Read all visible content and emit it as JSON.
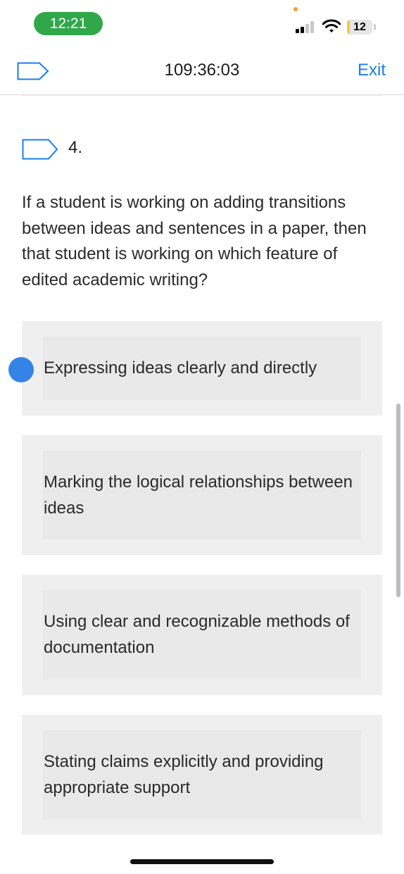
{
  "status_bar": {
    "time": "12:21",
    "battery_level": "12",
    "battery_fraction": 0.12,
    "signal_icon": "cellular-signal-icon",
    "wifi_icon": "wifi-icon",
    "battery_icon": "battery-icon"
  },
  "header": {
    "flag_icon": "flag-outline-icon",
    "timer": "109:36:03",
    "exit_label": "Exit"
  },
  "question": {
    "number": "4.",
    "text": "If a student is working on adding transitions between ideas and sentences in a paper, then that student is working on which feature of edited academic writing?",
    "options": [
      {
        "label": "Expressing ideas clearly and directly",
        "selected": true
      },
      {
        "label": "Marking the logical relationships between ideas",
        "selected": false
      },
      {
        "label": "Using clear and recognizable methods of documentation",
        "selected": false
      },
      {
        "label": "Stating claims explicitly and providing appropriate support",
        "selected": false
      }
    ]
  },
  "colors": {
    "accent": "#1a7cf0",
    "selected_radio": "#3483e6",
    "time_pill": "#30a84a",
    "option_bg": "#efefef"
  }
}
